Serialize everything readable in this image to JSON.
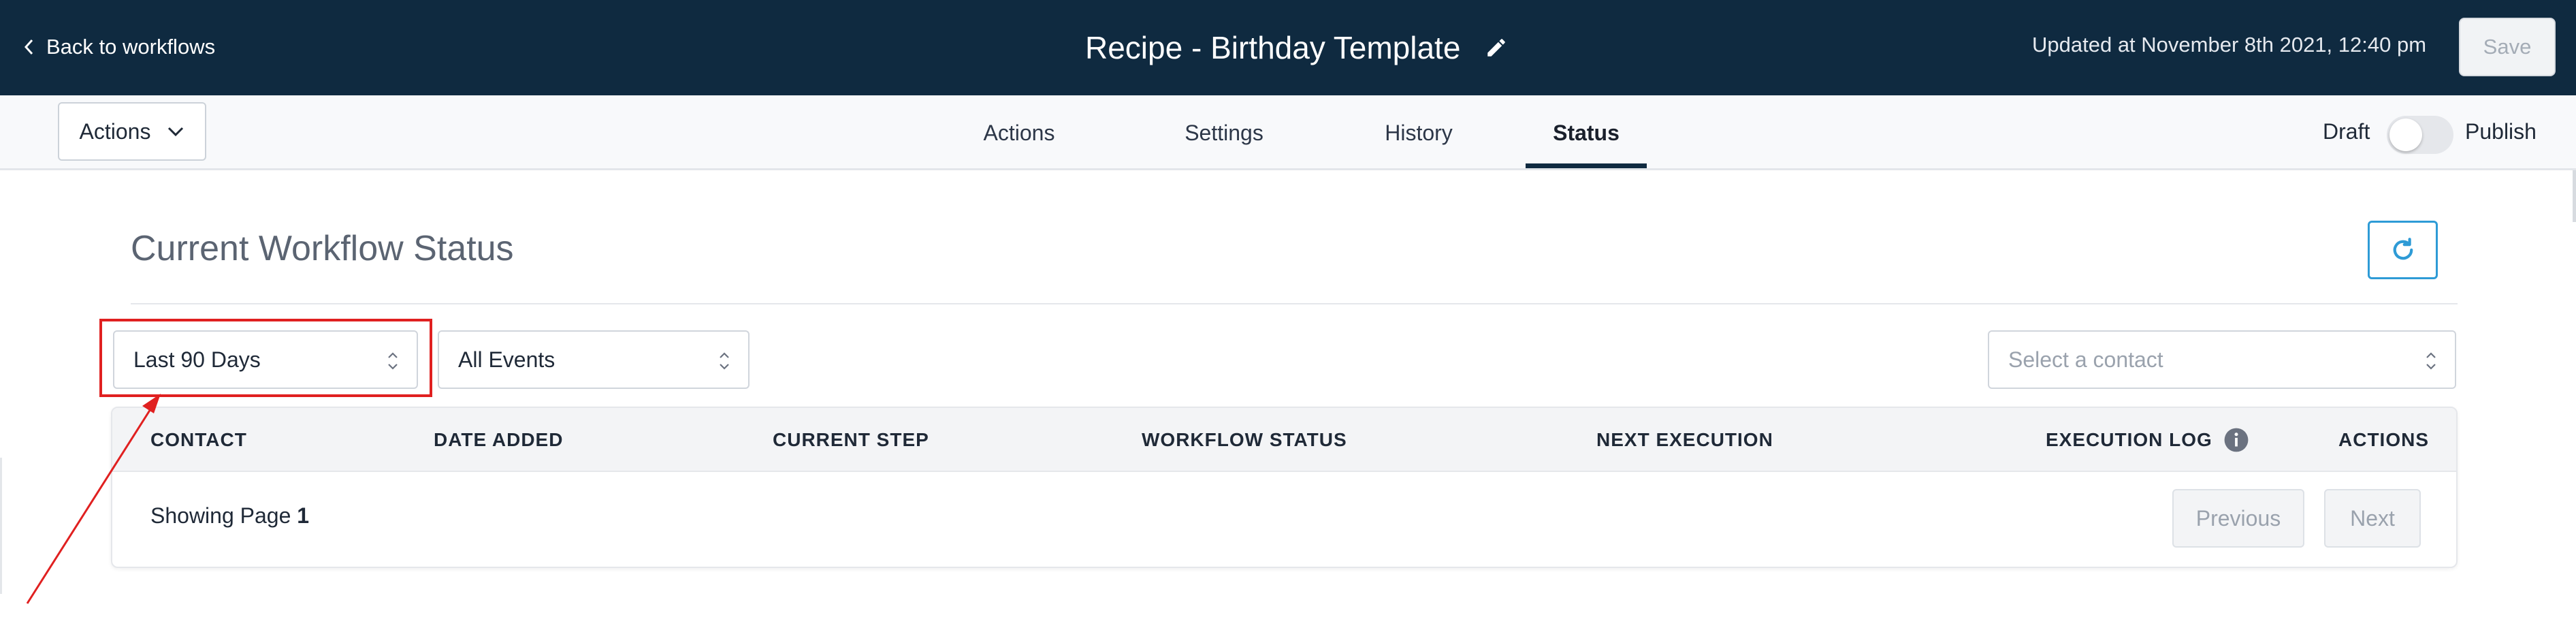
{
  "header": {
    "back_label": "Back to workflows",
    "title": "Recipe - Birthday Template",
    "updated": "Updated at November 8th 2021, 12:40 pm",
    "save_label": "Save",
    "background_color": "#0f2a40"
  },
  "subnav": {
    "actions_dropdown": "Actions",
    "tabs": [
      {
        "label": "Actions",
        "active": false
      },
      {
        "label": "Settings",
        "active": false
      },
      {
        "label": "History",
        "active": false
      },
      {
        "label": "Status",
        "active": true
      }
    ],
    "draft_label": "Draft",
    "publish_label": "Publish",
    "published": false
  },
  "status": {
    "section_title": "Current Workflow Status",
    "date_range": "Last 90 Days",
    "event_filter": "All Events",
    "contact_placeholder": "Select a contact",
    "accent_color": "#2e9bd6",
    "highlight_color": "#e02020"
  },
  "table": {
    "columns": [
      "CONTACT",
      "DATE ADDED",
      "CURRENT STEP",
      "WORKFLOW STATUS",
      "NEXT EXECUTION",
      "EXECUTION LOG",
      "ACTIONS"
    ],
    "showing_prefix": "Showing Page",
    "page_number": "1",
    "previous_label": "Previous",
    "next_label": "Next"
  }
}
